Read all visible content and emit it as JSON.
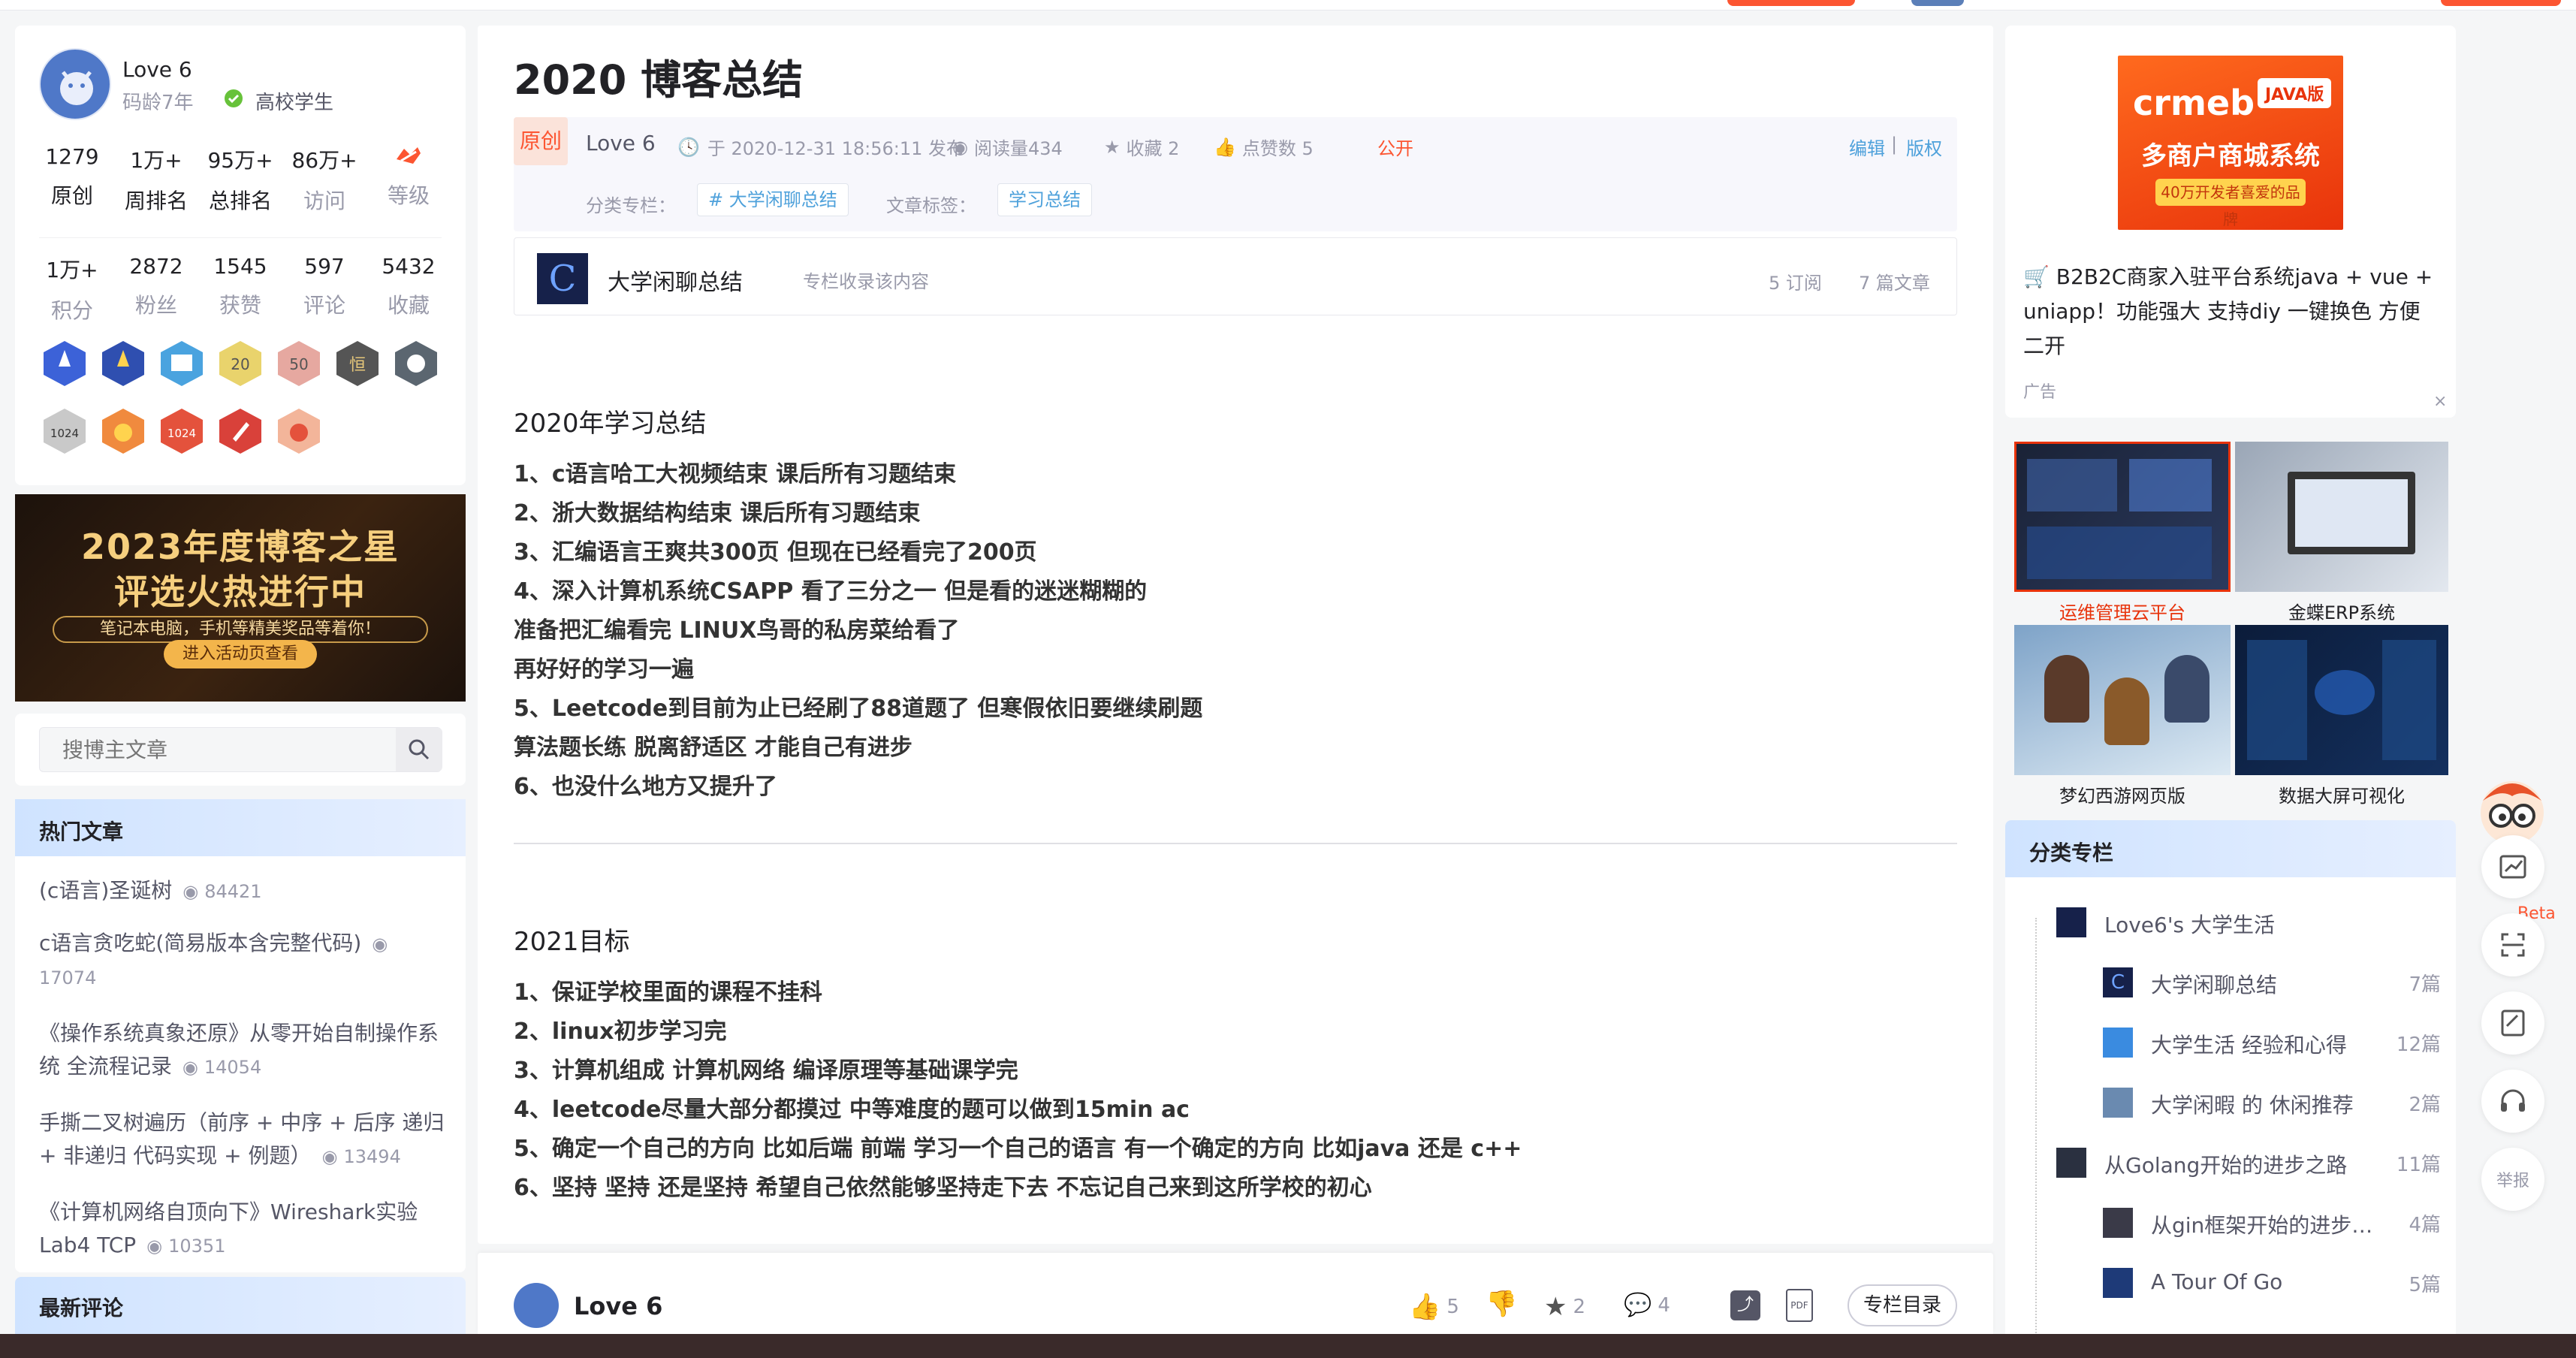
{
  "profile": {
    "name": "Love 6",
    "code_age": "码龄7年",
    "badge": "高校学生",
    "stats1": [
      {
        "v": "1279",
        "l": "原创"
      },
      {
        "v": "1万+",
        "l": "周排名"
      },
      {
        "v": "95万+",
        "l": "总排名"
      },
      {
        "v": "86万+",
        "l": "访问"
      },
      {
        "v": "",
        "l": "等级"
      }
    ],
    "stats2": [
      {
        "v": "1万+",
        "l": "积分"
      },
      {
        "v": "2872",
        "l": "粉丝"
      },
      {
        "v": "1545",
        "l": "获赞"
      },
      {
        "v": "597",
        "l": "评论"
      },
      {
        "v": "5432",
        "l": "收藏"
      }
    ]
  },
  "banner": {
    "line1": "2023年度博客之星",
    "line2": "评选火热进行中",
    "line3": "笔记本电脑，手机等精美奖品等着你！",
    "button": "进入活动页查看"
  },
  "search": {
    "placeholder": "搜博主文章"
  },
  "hot": {
    "title": "热门文章",
    "items": [
      {
        "title": "(c语言)圣诞树",
        "count": "84421"
      },
      {
        "title": "c语言贪吃蛇(简易版本含完整代码)",
        "count": "17074"
      },
      {
        "title": "《操作系统真象还原》从零开始自制操作系统 全流程记录",
        "count": "14054"
      },
      {
        "title": "手撕二叉树遍历（前序 + 中序 + 后序 递归 + 非递归 代码实现 + 例题）",
        "count": "13494"
      },
      {
        "title": "《计算机网络自顶向下》Wireshark实验 Lab4 TCP",
        "count": "10351"
      }
    ]
  },
  "latest_comments": {
    "title": "最新评论"
  },
  "article": {
    "title": "2020 博客总结",
    "tag_original": "原创",
    "author": "Love 6",
    "time": "于 2020-12-31 18:56:11 发布",
    "reads": "阅读量434",
    "fav": "收藏 2",
    "likes": "点赞数 5",
    "public": "公开",
    "edit": "编辑",
    "copyright": "版权",
    "column_label": "分类专栏：",
    "column_tag": "# 大学闲聊总结",
    "tag_label": "文章标签：",
    "tag": "学习总结",
    "column_box": {
      "name": "大学闲聊总结",
      "note": "专栏收录该内容",
      "subs": "5 订阅",
      "count": "7 篇文章"
    },
    "h1": "2020年学习总结",
    "list1": [
      "1、c语言哈工大视频结束 课后所有习题结束",
      "2、浙大数据结构结束 课后所有习题结束",
      "3、汇编语言王爽共300页 但现在已经看完了200页",
      "4、深入计算机系统CSAPP 看了三分之一 但是看的迷迷糊糊的",
      "准备把汇编看完 LINUX鸟哥的私房菜给看了",
      "再好好的学习一遍",
      "5、Leetcode到目前为止已经刷了88道题了 但寒假依旧要继续刷题",
      "算法题长练 脱离舒适区 才能自己有进步",
      "6、也没什么地方又提升了"
    ],
    "h2": "2021目标",
    "list2": [
      "1、保证学校里面的课程不挂科",
      "2、linux初步学习完",
      "3、计算机组成 计算机网络 编译原理等基础课学完",
      "4、leetcode尽量大部分都摸过 中等难度的题可以做到15min ac",
      "5、确定一个自己的方向 比如后端 前端 学习一个自己的语言 有一个确定的方向 比如java 还是 c++",
      "6、坚持 坚持 还是坚持 希望自己依然能够坚持走下去 不忘记自己来到这所学校的初心"
    ]
  },
  "footer": {
    "author": "Love 6",
    "likes": "5",
    "favs": "2",
    "comments": "4",
    "catalog": "专栏目录"
  },
  "ad": {
    "logo": "crmeb",
    "badge": "JAVA版",
    "headline": "多商户商城系统",
    "sub": "40万开发者喜爱的品牌",
    "text": "🛒 B2B2C商家入驻平台系统java + vue + uniapp！功能强大 支持diy 一键换色 方便二开",
    "label": "广告",
    "close": "×"
  },
  "tiles": [
    {
      "label": "运维管理云平台"
    },
    {
      "label": "金蝶ERP系统"
    },
    {
      "label": "梦幻西游网页版"
    },
    {
      "label": "数据大屏可视化"
    }
  ],
  "columns": {
    "title": "分类专栏",
    "items": [
      {
        "name": "Love6's 大学生活",
        "count": ""
      },
      {
        "name": "大学闲聊总结",
        "count": "7篇"
      },
      {
        "name": "大学生活 经验和心得",
        "count": "12篇"
      },
      {
        "name": "大学闲暇 的 休闲推荐",
        "count": "2篇"
      },
      {
        "name": "从Golang开始的进步之路",
        "count": "11篇"
      },
      {
        "name": "从gin框架开始的进步…",
        "count": "4篇"
      },
      {
        "name": "A Tour Of Go",
        "count": "5篇"
      }
    ]
  },
  "floating": {
    "beta": "Beta",
    "report": "举报"
  },
  "colors": {
    "accent": "#fc5531",
    "link": "#4ea1db",
    "blue_panel": "#cfe3ff"
  }
}
